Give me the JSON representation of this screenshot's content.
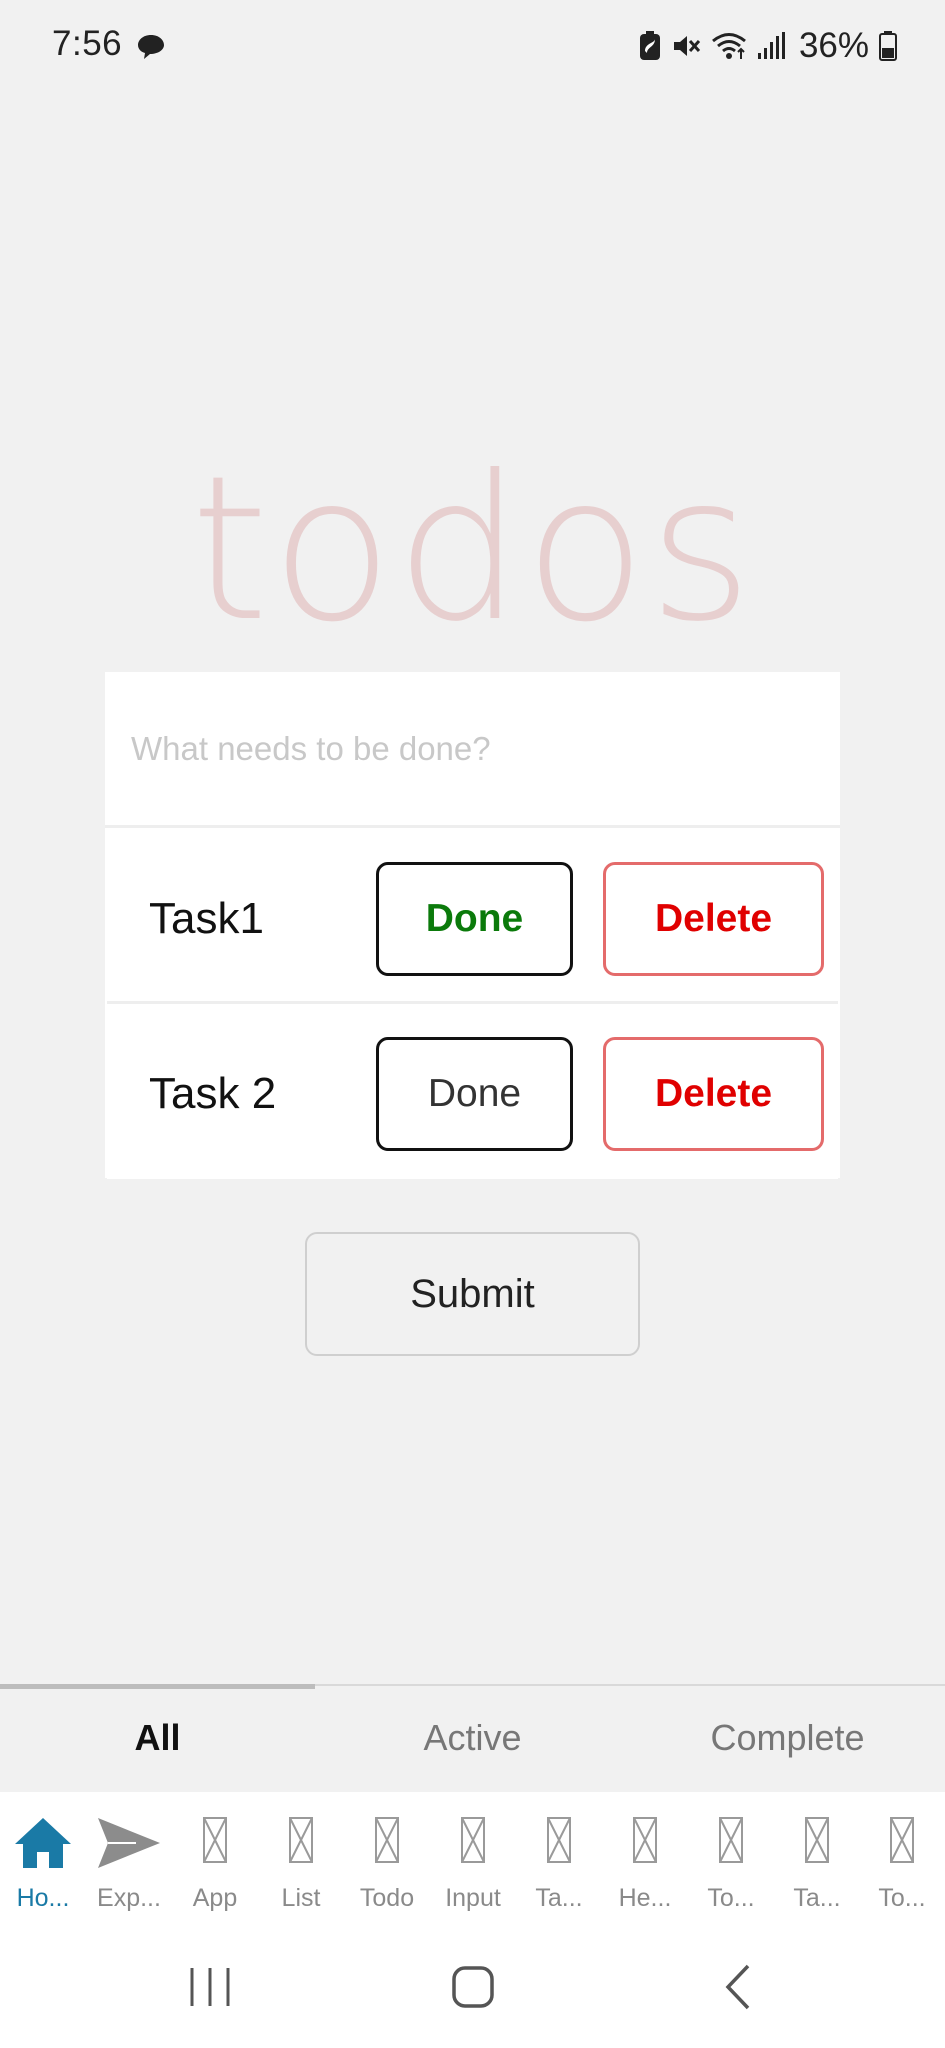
{
  "status_bar": {
    "time": "7:56",
    "battery": "36%",
    "icons": [
      "chat-bubble-icon",
      "battery-saver-icon",
      "mute-icon",
      "wifi-icon",
      "signal-icon",
      "battery-icon"
    ]
  },
  "app": {
    "title": "todos",
    "input_placeholder": "What needs to be done?",
    "submit_label": "Submit"
  },
  "todos": [
    {
      "label": "Task1",
      "done_label": "Done",
      "delete_label": "Delete",
      "completed": true
    },
    {
      "label": "Task 2",
      "done_label": "Done",
      "delete_label": "Delete",
      "completed": false
    }
  ],
  "filters": {
    "selected": "All",
    "tabs": [
      "All",
      "Active",
      "Complete"
    ]
  },
  "bottom_nav": {
    "selected_index": 0,
    "items": [
      {
        "label": "Ho...",
        "icon": "home-icon"
      },
      {
        "label": "Exp...",
        "icon": "send-icon"
      },
      {
        "label": "App",
        "icon": "missing-image-icon"
      },
      {
        "label": "List",
        "icon": "missing-image-icon"
      },
      {
        "label": "Todo",
        "icon": "missing-image-icon"
      },
      {
        "label": "Input",
        "icon": "missing-image-icon"
      },
      {
        "label": "Ta...",
        "icon": "missing-image-icon"
      },
      {
        "label": "He...",
        "icon": "missing-image-icon"
      },
      {
        "label": "To...",
        "icon": "missing-image-icon"
      },
      {
        "label": "Ta...",
        "icon": "missing-image-icon"
      },
      {
        "label": "To...",
        "icon": "missing-image-icon"
      }
    ]
  },
  "colors": {
    "accent": "#1a7aa6",
    "done_green": "#0b7a0b",
    "delete_red": "#e00000",
    "title_pink": "#e7cfcf",
    "background": "#f1f1f1"
  }
}
